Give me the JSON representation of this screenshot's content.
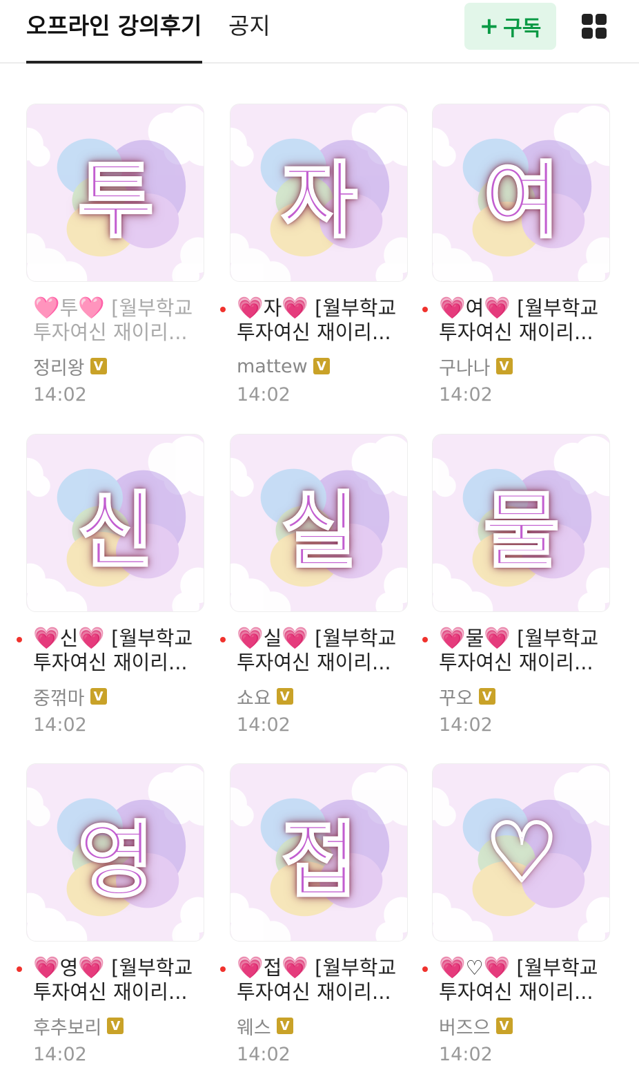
{
  "header": {
    "tabs": [
      {
        "label": "오프라인 강의후기",
        "active": true
      },
      {
        "label": "공지",
        "active": false
      }
    ],
    "subscribe_plus": "+",
    "subscribe_label": "구독",
    "icon_grid": "grid-view-icon"
  },
  "colors": {
    "accent_green": "#0a9a45",
    "subscribe_bg": "#e2f6e9",
    "new_dot": "#f0322d",
    "heart": "#e2179d",
    "glyph": "#c25ed0",
    "badge": "#c9a228"
  },
  "posts": [
    {
      "thumb_glyph": "투",
      "heart_left": "🩷",
      "title_char": "투",
      "heart_right": "🩷",
      "title_rest": " [월부학교",
      "title_line2": "투자여신 재이리...",
      "author": "정리왕",
      "badge": "V",
      "time": "14:02",
      "is_new": false
    },
    {
      "thumb_glyph": "자",
      "heart_left": "💗",
      "title_char": "자",
      "heart_right": "💗",
      "title_rest": " [월부학교",
      "title_line2": "투자여신 재이리...",
      "author": "mattew",
      "badge": "V",
      "time": "14:02",
      "is_new": true
    },
    {
      "thumb_glyph": "여",
      "heart_left": "💗",
      "title_char": "여",
      "heart_right": "💗",
      "title_rest": " [월부학교",
      "title_line2": "투자여신 재이리...",
      "author": "구나나",
      "badge": "V",
      "time": "14:02",
      "is_new": true
    },
    {
      "thumb_glyph": "신",
      "heart_left": "💗",
      "title_char": "신",
      "heart_right": "💗",
      "title_rest": " [월부학교",
      "title_line2": "투자여신 재이리...",
      "author": "중꺾마",
      "badge": "V",
      "time": "14:02",
      "is_new": true
    },
    {
      "thumb_glyph": "실",
      "heart_left": "💗",
      "title_char": "실",
      "heart_right": "💗",
      "title_rest": " [월부학교",
      "title_line2": "투자여신 재이리...",
      "author": "쇼요",
      "badge": "V",
      "time": "14:02",
      "is_new": true
    },
    {
      "thumb_glyph": "물",
      "heart_left": "💗",
      "title_char": "물",
      "heart_right": "💗",
      "title_rest": " [월부학교",
      "title_line2": "투자여신 재이리...",
      "author": "꾸오",
      "badge": "V",
      "time": "14:02",
      "is_new": true
    },
    {
      "thumb_glyph": "영",
      "heart_left": "💗",
      "title_char": "영",
      "heart_right": "💗",
      "title_rest": " [월부학교",
      "title_line2": "투자여신 재이리...",
      "author": "후추보리",
      "badge": "V",
      "time": "14:02",
      "is_new": true
    },
    {
      "thumb_glyph": "접",
      "heart_left": "💗",
      "title_char": "접",
      "heart_right": "💗",
      "title_rest": " [월부학교",
      "title_line2": "투자여신 재이리...",
      "author": "웨스",
      "badge": "V",
      "time": "14:02",
      "is_new": true
    },
    {
      "thumb_glyph": "♡",
      "heart_left": "💗",
      "title_char": "♡",
      "heart_right": "💗",
      "title_rest": " [월부학교",
      "title_line2": "투자여신 재이리...",
      "author": "버즈으",
      "badge": "V",
      "time": "14:02",
      "is_new": true
    }
  ]
}
